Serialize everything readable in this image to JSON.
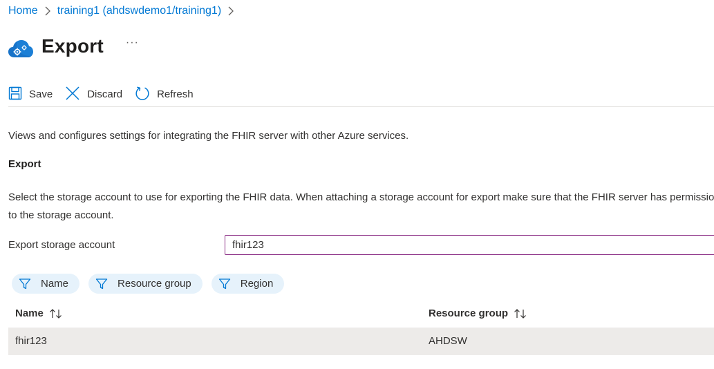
{
  "breadcrumb": {
    "home": "Home",
    "resource": "training1 (ahdswdemo1/training1)"
  },
  "header": {
    "title": "Export",
    "more": "···"
  },
  "toolbar": {
    "save_label": "Save",
    "discard_label": "Discard",
    "refresh_label": "Refresh"
  },
  "description": "Views and configures settings for integrating the FHIR server with other Azure services.",
  "section": {
    "heading": "Export",
    "info": "Select the storage account to use for exporting the FHIR data. When attaching a storage account for export make sure that the FHIR server has permission to the storage account."
  },
  "storage_field": {
    "label": "Export storage account",
    "value": "fhir123"
  },
  "filters": [
    {
      "label": "Name"
    },
    {
      "label": "Resource group"
    },
    {
      "label": "Region"
    }
  ],
  "grid": {
    "columns": [
      "Name",
      "Resource group"
    ],
    "rows": [
      {
        "name": "fhir123",
        "resource_group": "AHDSW"
      }
    ]
  },
  "colors": {
    "link": "#0078d4",
    "input_border": "#8a2b84",
    "pill_bg": "#e6f2fb",
    "row_selected_bg": "#edebe9"
  },
  "icons": {
    "resource": "cloud-gear-icon",
    "save": "save-icon",
    "discard": "close-icon",
    "refresh": "refresh-icon",
    "filter": "filter-icon",
    "sort": "sort-icon",
    "chevron": "chevron-right-icon"
  }
}
